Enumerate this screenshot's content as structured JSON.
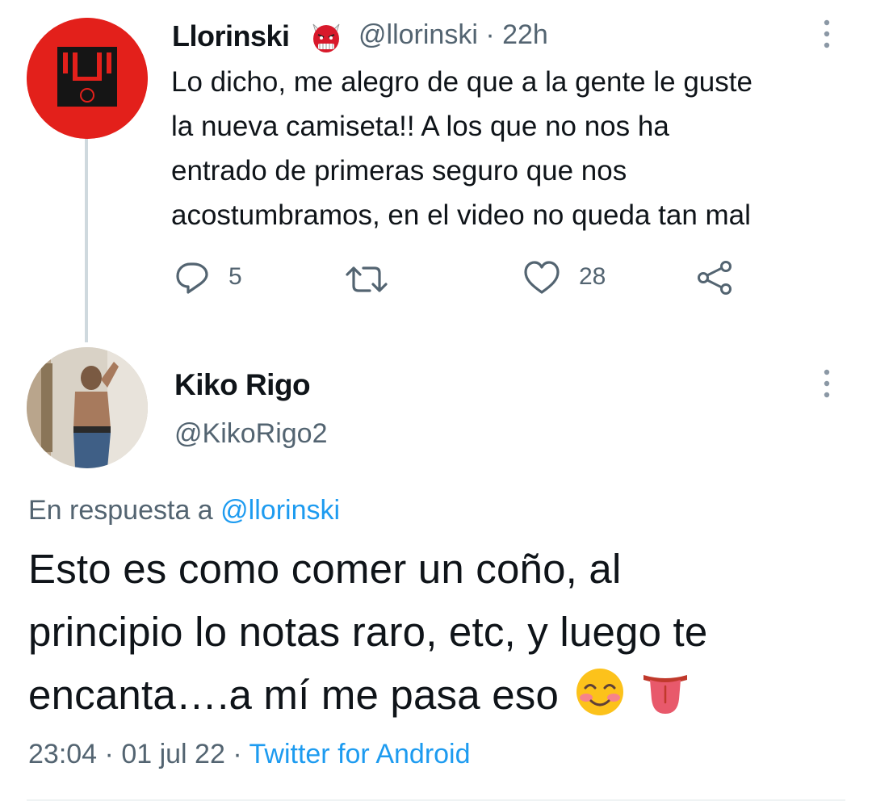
{
  "tweet1": {
    "name": "Llorinski",
    "badge_icon": "ogre-emoji-icon",
    "handle": "@llorinski",
    "separator": "·",
    "time": "22h",
    "text_lines": [
      "Lo dicho, me alegro de que a la gente le guste",
      "la nueva camiseta!! A los que no nos ha",
      "entrado de primeras seguro que nos",
      "acostumbramos, en el video no queda tan mal"
    ],
    "actions": {
      "reply_count": "5",
      "retweet_count": "",
      "like_count": "28"
    }
  },
  "tweet2": {
    "name": "Kiko Rigo",
    "handle": "@KikoRigo2",
    "reply_prefix": "En respuesta a",
    "reply_to": "@llorinski",
    "text_lines": [
      "Esto es como comer un coño, al",
      "principio lo notas raro, etc, y luego te",
      "encanta….a mí me pasa eso"
    ],
    "emojis": [
      "smiling-face-with-smiling-eyes-icon",
      "tongue-icon"
    ],
    "time": "23:04",
    "sep1": "·",
    "date": "01 jul 22",
    "sep2": "·",
    "source": "Twitter for Android"
  },
  "colors": {
    "accent": "#1d9bf0",
    "muted": "#536471",
    "text": "#0f1419",
    "avatar_red": "#e3201b"
  }
}
